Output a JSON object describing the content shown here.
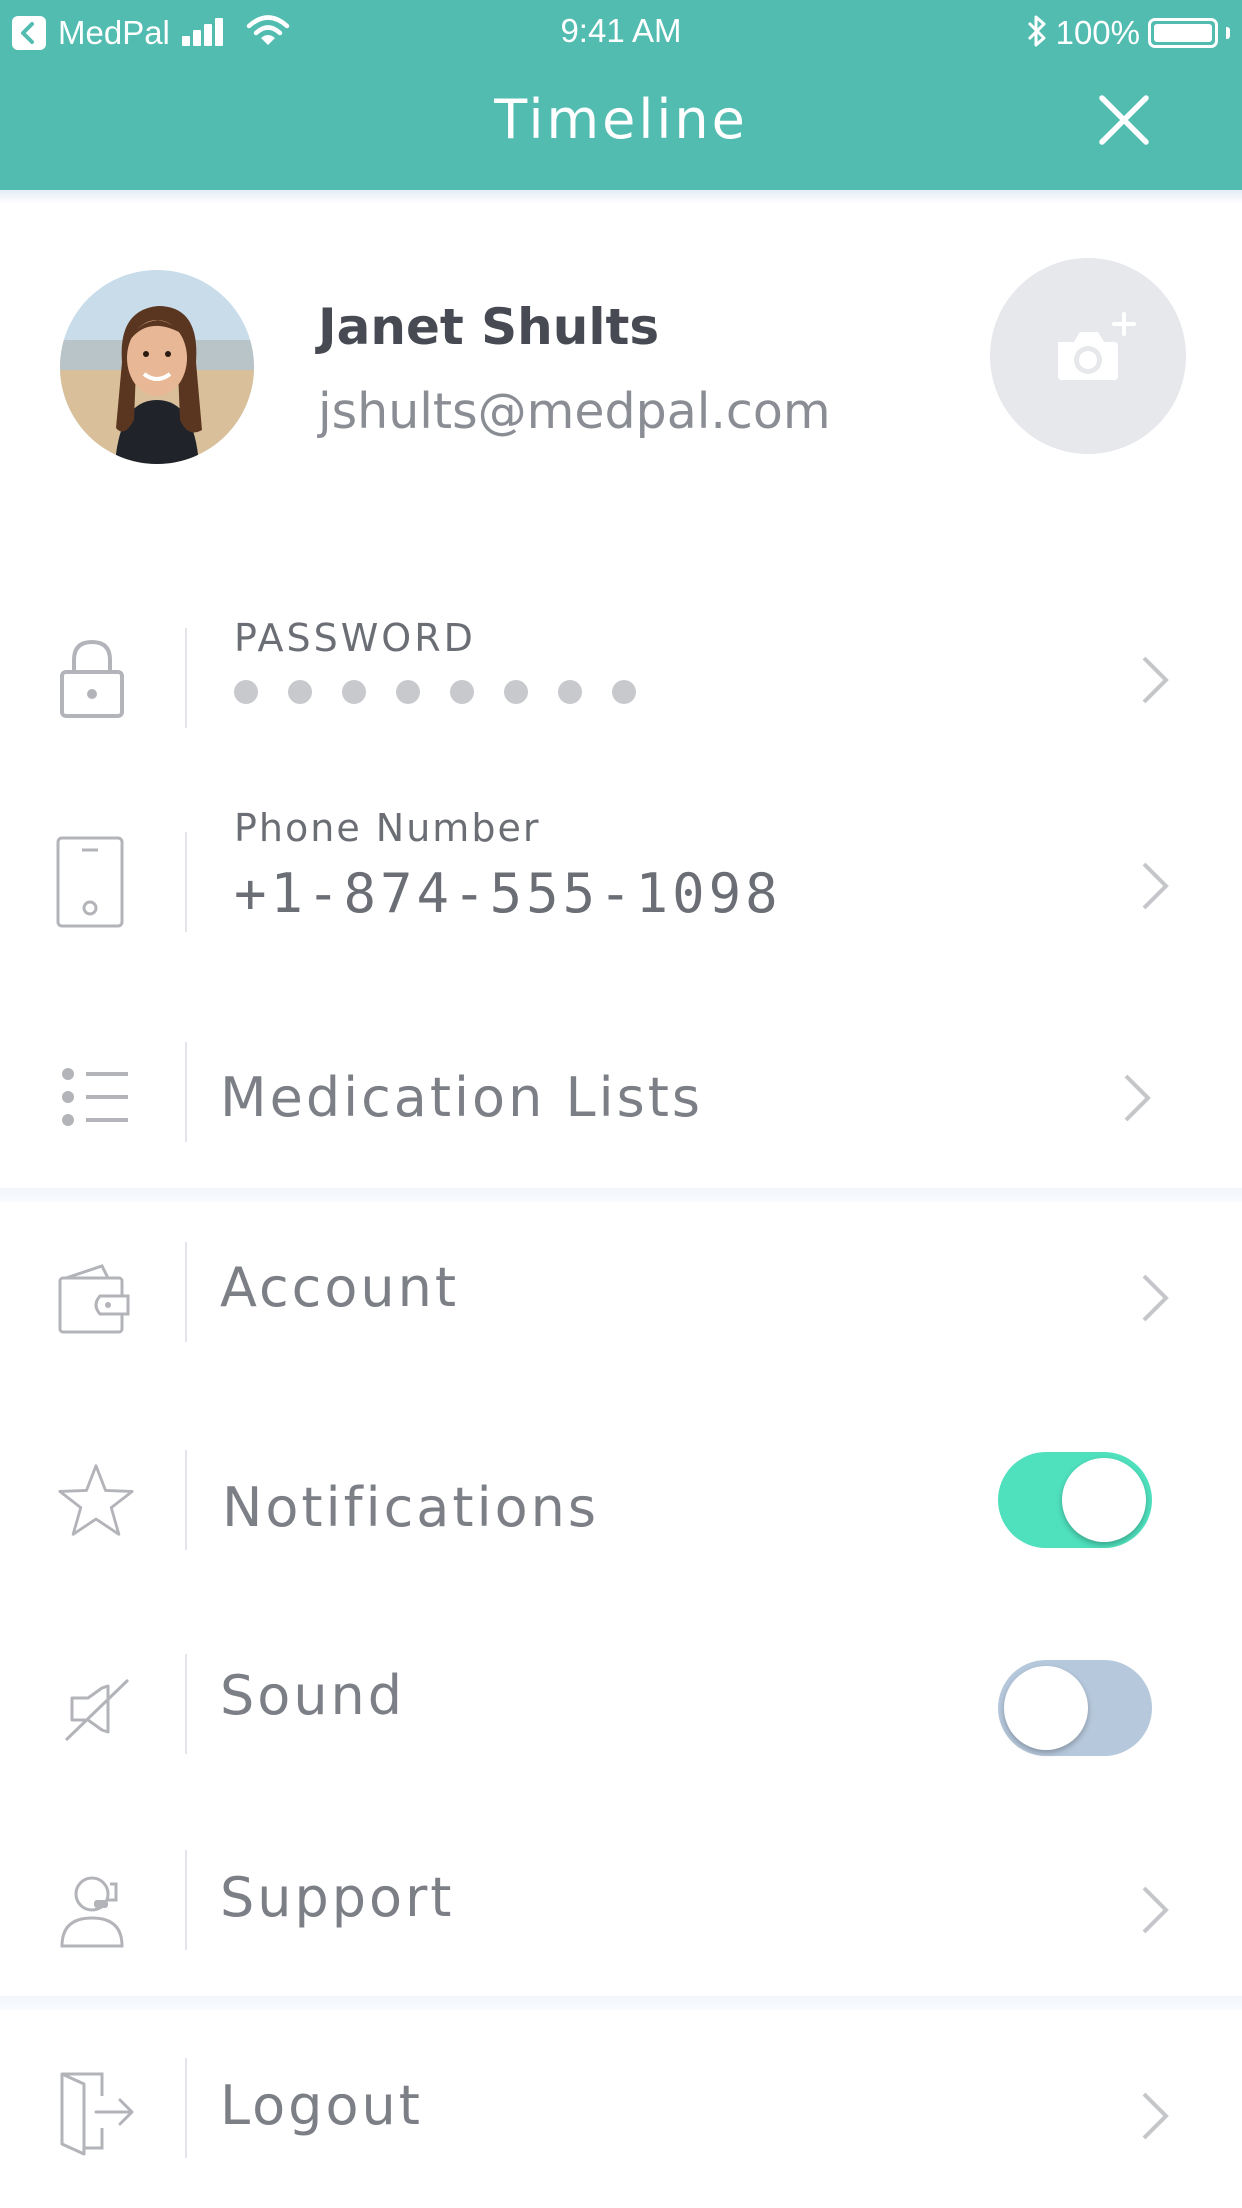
{
  "status_bar": {
    "back_app": "MedPal",
    "time": "9:41 AM",
    "battery": "100%",
    "battery_level": 1.0
  },
  "header": {
    "title": "Timeline",
    "background": "#52bcb1"
  },
  "profile": {
    "name": "Janet Shults",
    "email": "jshults@medpal.com"
  },
  "settings": {
    "password": {
      "label": "PASSWORD",
      "masked_length": 8
    },
    "phone": {
      "label": "Phone Number",
      "value": "+1-874-555-1098"
    },
    "medication_lists": {
      "label": "Medication Lists"
    },
    "account": {
      "label": "Account"
    },
    "notifications": {
      "label": "Notifications",
      "enabled": true
    },
    "sound": {
      "label": "Sound",
      "enabled": false
    },
    "support": {
      "label": "Support"
    },
    "logout": {
      "label": "Logout"
    }
  },
  "colors": {
    "toggle_on": "#4fe0bd",
    "toggle_off": "#b6c8dc",
    "text": "#7c7f86"
  },
  "icons": [
    "back-arrow-icon",
    "signal-icon",
    "wifi-icon",
    "bluetooth-icon",
    "battery-icon",
    "close-icon",
    "camera-add-icon",
    "lock-icon",
    "phone-icon",
    "list-icon",
    "wallet-icon",
    "star-icon",
    "sound-off-icon",
    "support-icon",
    "logout-icon",
    "chevron-right-icon"
  ]
}
